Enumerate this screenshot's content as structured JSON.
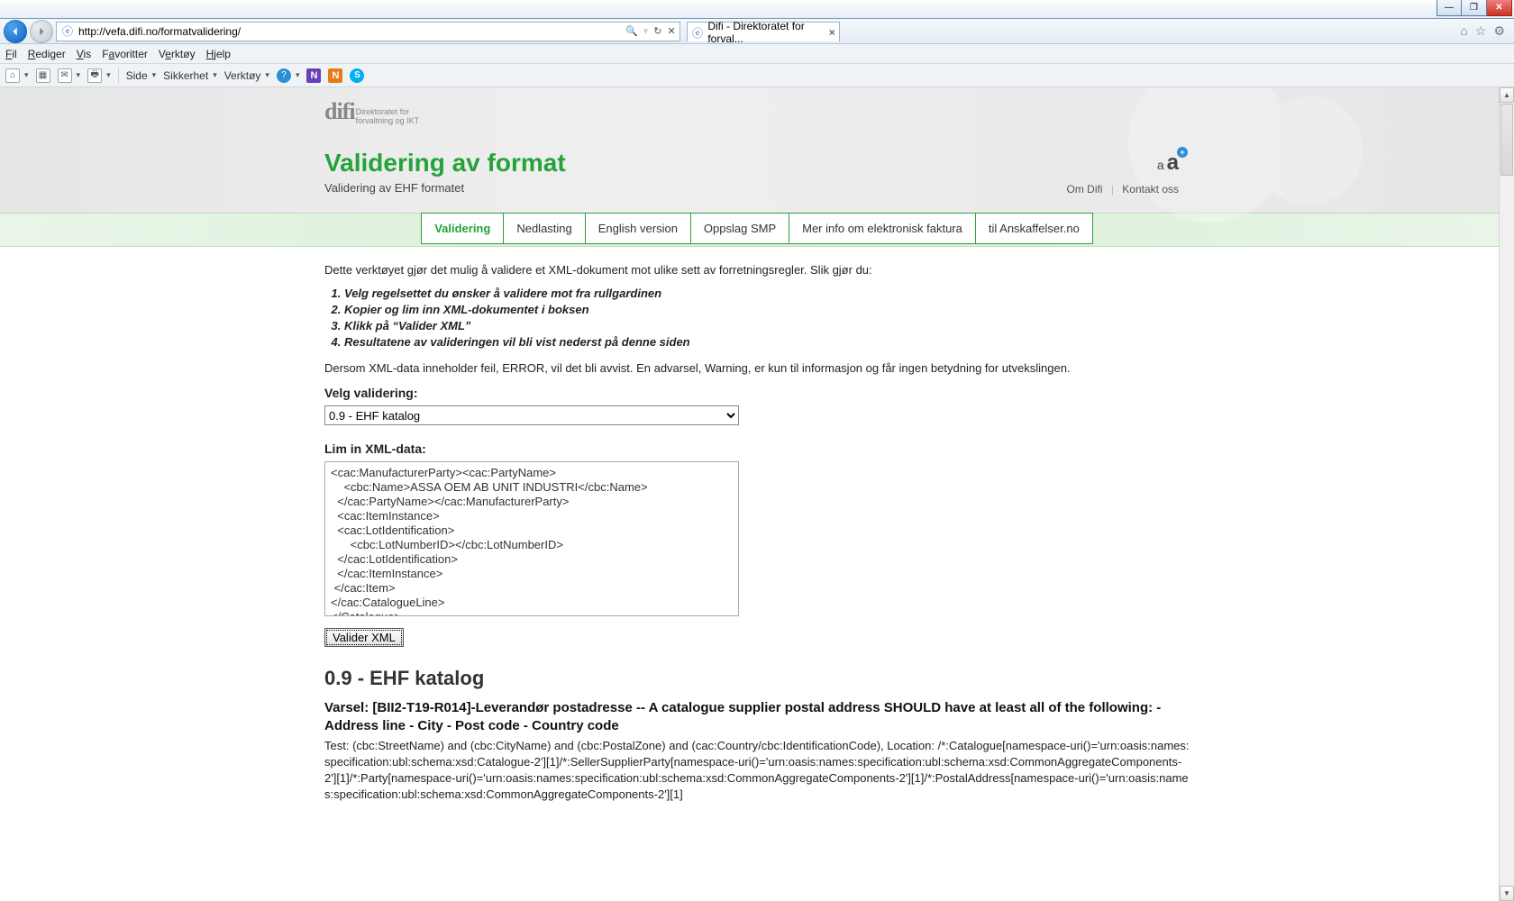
{
  "window": {
    "url": "http://vefa.difi.no/formatvalidering/",
    "search_hint": "",
    "tab_title": "Difi - Direktoratet for forval...",
    "minimize": "—",
    "maximize": "❐",
    "close": "✕"
  },
  "menus": {
    "file": "Fil",
    "edit": "Rediger",
    "view": "Vis",
    "fav": "Favoritter",
    "tools": "Verktøy",
    "help": "Hjelp"
  },
  "toolbar": {
    "side": "Side",
    "sikkerhet": "Sikkerhet",
    "verktoy": "Verktøy"
  },
  "addr_icons": {
    "search": "🔍",
    "refresh": "↻",
    "stop": "✕"
  },
  "top_icons": {
    "home": "⌂",
    "star": "☆",
    "gear": "⚙"
  },
  "logo": {
    "brand": "difi",
    "sub1": "Direktoratet for",
    "sub2": "forvaltning og IKT"
  },
  "header": {
    "title": "Validering av format",
    "subtitle": "Validering av EHF formatet",
    "toplinks": {
      "om": "Om Difi",
      "kontakt": "Kontakt oss"
    }
  },
  "font_ctrl": {
    "small": "a",
    "large": "a",
    "plus": "+"
  },
  "nav": {
    "items": [
      {
        "label": "Validering",
        "active": true
      },
      {
        "label": "Nedlasting"
      },
      {
        "label": "English version"
      },
      {
        "label": "Oppslag SMP"
      },
      {
        "label": "Mer info om elektronisk faktura"
      },
      {
        "label": "til Anskaffelser.no"
      }
    ]
  },
  "intro": "Dette verktøyet gjør det mulig å validere et XML-dokument mot ulike sett av forretningsregler. Slik gjør du:",
  "steps": [
    "Velg regelsettet du ønsker å validere mot fra rullgardinen",
    "Kopier og lim inn XML-dokumentet i boksen",
    "Klikk på “Valider XML”",
    "Resultatene av valideringen vil bli vist nederst på denne siden"
  ],
  "note": "Dersom XML-data inneholder feil, ERROR, vil det bli avvist. En advarsel, Warning, er kun til informasjon og får ingen betydning for utvekslingen.",
  "form": {
    "select_label": "Velg validering:",
    "select_value": "0.9 - EHF katalog",
    "textarea_label": "Lim in XML-data:",
    "textarea_value": "<cac:ManufacturerParty><cac:PartyName>\n    <cbc:Name>ASSA OEM AB UNIT INDUSTRI</cbc:Name>\n  </cac:PartyName></cac:ManufacturerParty>\n  <cac:ItemInstance>\n  <cac:LotIdentification>\n      <cbc:LotNumberID></cbc:LotNumberID>\n  </cac:LotIdentification>\n  </cac:ItemInstance>\n </cac:Item>\n</cac:CatalogueLine>\n</Catalogue>",
    "button": "Valider XML"
  },
  "result": {
    "heading": "0.9 - EHF katalog",
    "warn": "Varsel: [BII2-T19-R014]-Leverandør postadresse -- A catalogue supplier postal address SHOULD have at least all of the following: - Address line - City - Post code - Country code",
    "detail": "Test: (cbc:StreetName) and (cbc:CityName) and (cbc:PostalZone) and (cac:Country/cbc:IdentificationCode), Location: /*:Catalogue[namespace-uri()='urn:oasis:names:specification:ubl:schema:xsd:Catalogue-2'][1]/*:SellerSupplierParty[namespace-uri()='urn:oasis:names:specification:ubl:schema:xsd:CommonAggregateComponents-2'][1]/*:Party[namespace-uri()='urn:oasis:names:specification:ubl:schema:xsd:CommonAggregateComponents-2'][1]/*:PostalAddress[namespace-uri()='urn:oasis:names:specification:ubl:schema:xsd:CommonAggregateComponents-2'][1]"
  }
}
